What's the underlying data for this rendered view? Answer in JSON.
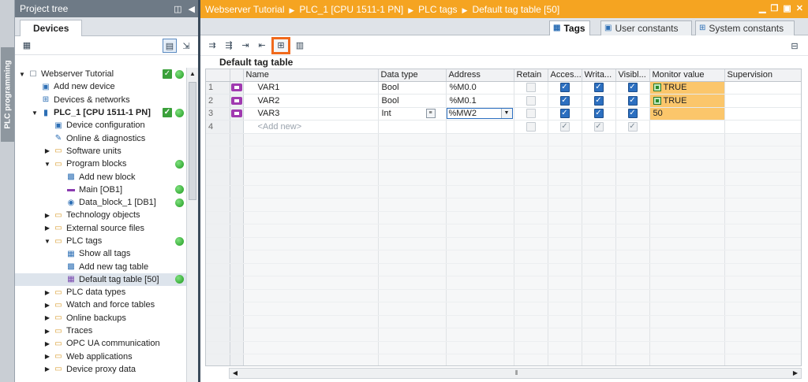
{
  "side_strip": {
    "label": "PLC programming"
  },
  "project_tree": {
    "title": "Project tree",
    "tab": "Devices",
    "items": [
      {
        "label": "Webserver Tutorial",
        "level": 0,
        "arrow": "open",
        "icon": "document-icon",
        "check": true,
        "dot": true
      },
      {
        "label": "Add new device",
        "level": 1,
        "arrow": "",
        "icon": "add-device-icon"
      },
      {
        "label": "Devices & networks",
        "level": 1,
        "arrow": "",
        "icon": "network-icon"
      },
      {
        "label": "PLC_1 [CPU 1511-1 PN]",
        "level": 1,
        "arrow": "open",
        "icon": "plc-icon",
        "bold": true,
        "check": true,
        "dot": true
      },
      {
        "label": "Device configuration",
        "level": 2,
        "arrow": "",
        "icon": "device-config-icon"
      },
      {
        "label": "Online & diagnostics",
        "level": 2,
        "arrow": "",
        "icon": "diagnostics-icon"
      },
      {
        "label": "Software units",
        "level": 2,
        "arrow": "closed",
        "icon": "folder-icon"
      },
      {
        "label": "Program blocks",
        "level": 2,
        "arrow": "open",
        "icon": "folder-icon",
        "dot": true
      },
      {
        "label": "Add new block",
        "level": 3,
        "arrow": "",
        "icon": "add-block-icon"
      },
      {
        "label": "Main [OB1]",
        "level": 3,
        "arrow": "",
        "icon": "ob-block-icon",
        "dot": true
      },
      {
        "label": "Data_block_1 [DB1]",
        "level": 3,
        "arrow": "",
        "icon": "db-block-icon",
        "dot": true
      },
      {
        "label": "Technology objects",
        "level": 2,
        "arrow": "closed",
        "icon": "folder-icon"
      },
      {
        "label": "External source files",
        "level": 2,
        "arrow": "closed",
        "icon": "folder-icon"
      },
      {
        "label": "PLC tags",
        "level": 2,
        "arrow": "open",
        "icon": "folder-icon",
        "dot": true
      },
      {
        "label": "Show all tags",
        "level": 3,
        "arrow": "",
        "icon": "tags-icon"
      },
      {
        "label": "Add new tag table",
        "level": 3,
        "arrow": "",
        "icon": "add-table-icon"
      },
      {
        "label": "Default tag table [50]",
        "level": 3,
        "arrow": "",
        "icon": "tag-table-icon",
        "selected": true,
        "dot": true
      },
      {
        "label": "PLC data types",
        "level": 2,
        "arrow": "closed",
        "icon": "folder-icon"
      },
      {
        "label": "Watch and force tables",
        "level": 2,
        "arrow": "closed",
        "icon": "folder-icon"
      },
      {
        "label": "Online backups",
        "level": 2,
        "arrow": "closed",
        "icon": "folder-icon"
      },
      {
        "label": "Traces",
        "level": 2,
        "arrow": "closed",
        "icon": "folder-icon"
      },
      {
        "label": "OPC UA communication",
        "level": 2,
        "arrow": "closed",
        "icon": "folder-icon"
      },
      {
        "label": "Web applications",
        "level": 2,
        "arrow": "closed",
        "icon": "folder-icon"
      },
      {
        "label": "Device proxy data",
        "level": 2,
        "arrow": "closed",
        "icon": "folder-icon"
      }
    ]
  },
  "editor": {
    "breadcrumb": [
      "Webserver Tutorial",
      "PLC_1 [CPU 1511-1 PN]",
      "PLC tags",
      "Default tag table [50]"
    ],
    "tabs": [
      {
        "label": "Tags",
        "active": true,
        "icon": "tags-icon"
      },
      {
        "label": "User constants",
        "active": false,
        "icon": "constants-icon"
      },
      {
        "label": "System constants",
        "active": false,
        "icon": "system-constants-icon"
      }
    ],
    "table_title": "Default tag table",
    "columns": [
      "",
      "",
      "Name",
      "Data type",
      "Address",
      "Retain",
      "Acces...",
      "Writa...",
      "Visibl...",
      "Monitor value",
      "Supervision"
    ],
    "rows": [
      {
        "num": "1",
        "name": "VAR1",
        "type": "Bool",
        "address": "%M0.0",
        "retain": false,
        "access": true,
        "write": true,
        "visible": true,
        "monitor": "TRUE",
        "mon_badge": true
      },
      {
        "num": "2",
        "name": "VAR2",
        "type": "Bool",
        "address": "%M0.1",
        "retain": false,
        "access": true,
        "write": true,
        "visible": true,
        "monitor": "TRUE",
        "mon_badge": true
      },
      {
        "num": "3",
        "name": "VAR3",
        "type": "Int",
        "address": "%MW2",
        "retain": false,
        "access": true,
        "write": true,
        "visible": true,
        "monitor": "50",
        "mon_badge": false,
        "editing": true
      }
    ],
    "add_row": {
      "num": "4",
      "placeholder": "<Add new>"
    },
    "accent": "#f5a421",
    "highlight_color": "#f06a1d"
  }
}
